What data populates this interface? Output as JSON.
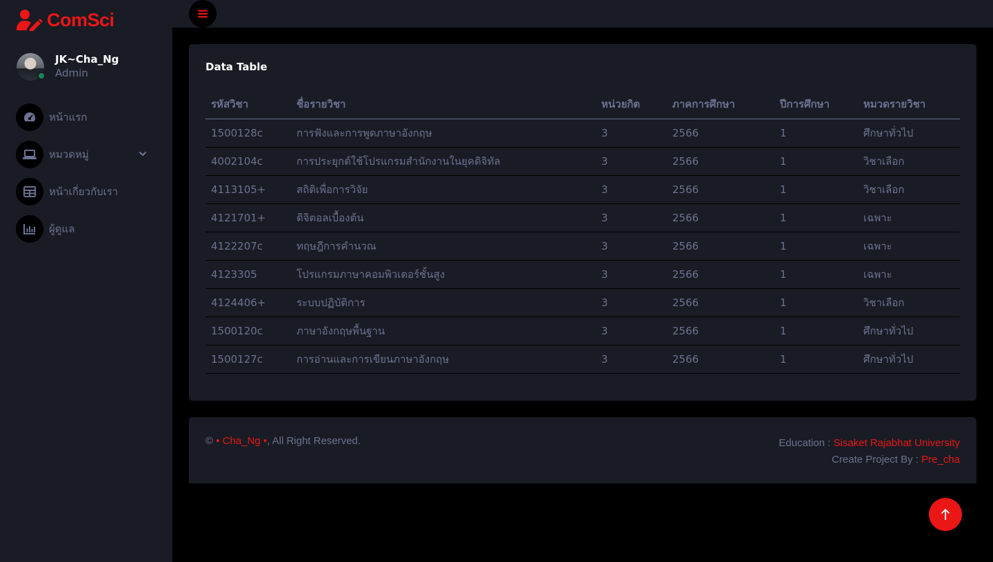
{
  "brand": {
    "name": "ComSci",
    "icon": "user-edit-icon",
    "accent_color": "#eb1616"
  },
  "profile": {
    "name": "JK~Cha_Ng",
    "role": "Admin",
    "status_color": "#198754"
  },
  "sidebar": {
    "items": [
      {
        "label": "หน้าแรก",
        "icon": "tachometer-icon"
      },
      {
        "label": "หมวดหมู่",
        "icon": "laptop-icon",
        "has_dropdown": true
      },
      {
        "label": "หน้าเกี่ยวกับเรา",
        "icon": "table-icon"
      },
      {
        "label": "ผู้ดูแล",
        "icon": "chart-bar-icon"
      }
    ]
  },
  "topbar": {
    "toggle_icon": "bars-icon"
  },
  "table_card": {
    "title": "Data Table",
    "headers": [
      "รหัสวิชา",
      "ชื่อรายวิชา",
      "หน่วยกิต",
      "ภาคการศึกษา",
      "ปีการศึกษา",
      "หมวดรายวิชา"
    ],
    "rows": [
      [
        "1500128c",
        "การฟังและการพูดภาษาอังกฤษ",
        "3",
        "2566",
        "1",
        "ศึกษาทั่วไป"
      ],
      [
        "4002104c",
        "การประยุกต์ใช้โปรแกรมสำนักงานในยุคดิจิทัล",
        "3",
        "2566",
        "1",
        "วิชาเลือก"
      ],
      [
        "4113105+",
        "สถิติเพื่อการวิจัย",
        "3",
        "2566",
        "1",
        "วิชาเลือก"
      ],
      [
        "4121701+",
        "ดิจิตอลเบื้องต้น",
        "3",
        "2566",
        "1",
        "เฉพาะ"
      ],
      [
        "4122207c",
        "ทฤษฎีการคำนวณ",
        "3",
        "2566",
        "1",
        "เฉพาะ"
      ],
      [
        "4123305",
        "โปรแกรมภาษาคอมพิวเตอร์ชั้นสูง",
        "3",
        "2566",
        "1",
        "เฉพาะ"
      ],
      [
        "4124406+",
        "ระบบปฏิบัติการ",
        "3",
        "2566",
        "1",
        "วิชาเลือก"
      ],
      [
        "1500120c",
        "ภาษาอังกฤษพื้นฐาน",
        "3",
        "2566",
        "1",
        "ศึกษาทั่วไป"
      ],
      [
        "1500127c",
        "การอ่านและการเขียนภาษาอังกฤษ",
        "3",
        "2566",
        "1",
        "ศึกษาทั่วไป"
      ]
    ]
  },
  "footer": {
    "copyright_symbol": "©",
    "copyright_link": "• Cha_Ng •",
    "copyright_suffix": ", All Right Reserved.",
    "education_label": "Education : ",
    "education_link": "Sisaket Rajabhat University",
    "project_label": "Create Project By : ",
    "project_link": "Pre_cha"
  },
  "back_to_top_icon": "arrow-up-icon"
}
